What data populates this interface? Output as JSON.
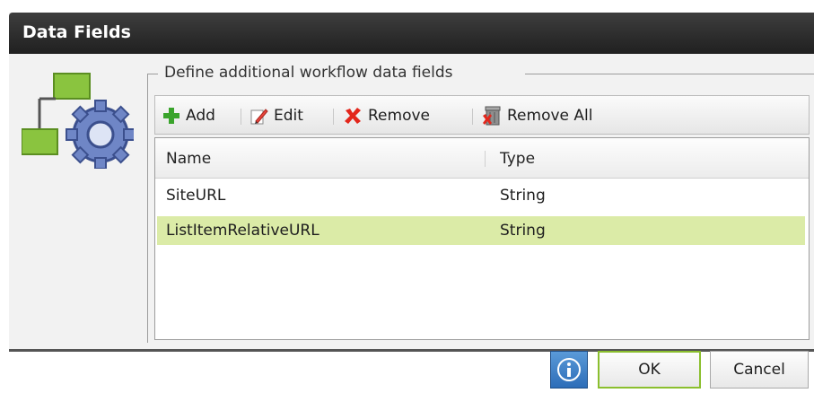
{
  "window": {
    "title": "Data Fields"
  },
  "group": {
    "legend": "Define additional workflow data fields"
  },
  "toolbar": {
    "add_label": "Add",
    "edit_label": "Edit",
    "remove_label": "Remove",
    "remove_all_label": "Remove All"
  },
  "grid": {
    "columns": [
      "Name",
      "Type"
    ],
    "rows": [
      {
        "name": "SiteURL",
        "type": "String",
        "selected": false
      },
      {
        "name": "ListItemRelativeURL",
        "type": "String",
        "selected": true
      }
    ]
  },
  "footer": {
    "info_icon": "info-icon",
    "ok_label": "OK",
    "cancel_label": "Cancel"
  },
  "colors": {
    "titlebar": "#2a2a2a",
    "selected_row": "#dbeba7",
    "ok_border": "#8bbf2e",
    "info_button": "#3a7fc8"
  }
}
